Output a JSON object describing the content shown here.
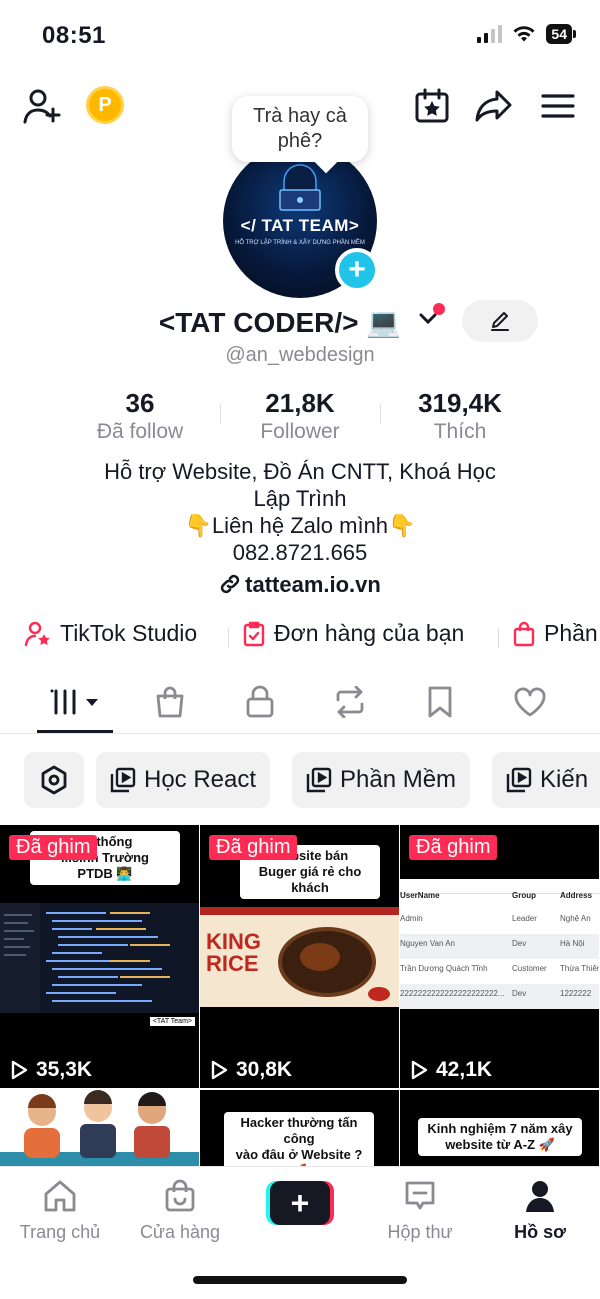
{
  "status": {
    "time": "08:51",
    "battery": "54"
  },
  "header": {
    "coin_label": "P"
  },
  "profile": {
    "bubble_text": "Trà hay cà phê?",
    "avatar_brand": "</ TAT TEAM>",
    "avatar_sub": "HỖ TRỢ LẬP TRÌNH & XÂY DỰNG PHẦN MỀM",
    "display_name": "<TAT CODER/> 💻",
    "handle": "@an_webdesign"
  },
  "stats": [
    {
      "value": "36",
      "label": "Đã follow"
    },
    {
      "value": "21,8K",
      "label": "Follower"
    },
    {
      "value": "319,4K",
      "label": "Thích"
    }
  ],
  "bio": {
    "line1": "Hỗ trợ Website, Đồ Án CNTT, Khoá Học",
    "line2": "Lập Trình",
    "line3": "👇Liên hệ Zalo mình👇",
    "line4": "082.8721.665",
    "link": "tatteam.io.vn"
  },
  "quick_links": [
    {
      "label": "TikTok Studio",
      "icon": "creator-icon"
    },
    {
      "label": "Đơn hàng của bạn",
      "icon": "order-icon"
    },
    {
      "label": "Phần",
      "icon": "bag-icon"
    }
  ],
  "playlists": [
    "Học React",
    "Phần Mềm",
    "Kiến"
  ],
  "videos": [
    {
      "pinned": "Đã ghim",
      "caption": "hệ thống\n...sinh Trường\nPTDB 👨‍💻",
      "views": "35,3K"
    },
    {
      "pinned": "Đã ghim",
      "caption": "Website bán\nBuger giá rẻ cho khách",
      "views": "30,8K",
      "thumb_title": "KING RICE"
    },
    {
      "pinned": "Đã ghim",
      "views": "42,1K",
      "table": {
        "headers": [
          "UserName",
          "Group",
          "Address"
        ],
        "rows": [
          [
            "Admin",
            "Leader",
            "Nghệ An"
          ],
          [
            "Nguyen Van An",
            "Dev",
            "Hà Nội"
          ],
          [
            "Trần Dương Quách Tĩnh",
            "Customer",
            "Thừa Thiên"
          ],
          [
            "2222222222222222222222...",
            "Dev",
            "1222222"
          ]
        ]
      }
    },
    {
      "caption": ""
    },
    {
      "caption": "Hacker thường tấn công\nvào đâu ở Website ? 🚀"
    },
    {
      "caption": "Kinh nghiệm 7 năm xây\nwebsite từ A-Z 🚀"
    }
  ],
  "tag_text": "<TAT Team>",
  "nav": [
    "Trang chủ",
    "Cửa hàng",
    "Hộp thư",
    "Hồ sơ"
  ],
  "colors": {
    "accent": "#fe2c55",
    "cyan": "#20c4e8",
    "coin": "#ffb800"
  }
}
